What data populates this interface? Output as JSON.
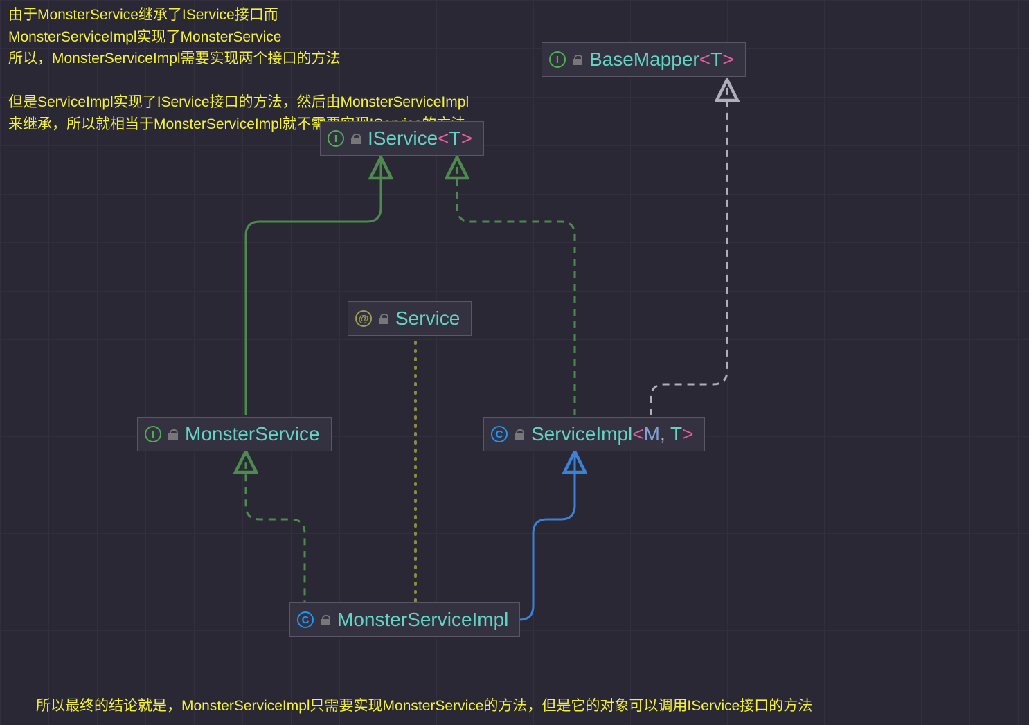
{
  "annotations": {
    "top": "由于MonsterService继承了IService接口而\nMonsterServiceImpl实现了MonsterService\n所以，MonsterServiceImpl需要实现两个接口的方法\n\n但是ServiceImpl实现了IService接口的方法，然后由MonsterServiceImpl\n来继承，所以就相当于MonsterServiceImpl就不需要实现IService的方法",
    "bottom": "所以最终的结论就是，MonsterServiceImpl只需要实现MonsterService的方法，但是它的对象可以调用IService接口的方法"
  },
  "nodes": {
    "basemapper": {
      "name": "BaseMapper",
      "generics": [
        {
          "txt": "<",
          "cls": "gen-br"
        },
        {
          "txt": "T",
          "cls": "gen-t"
        },
        {
          "txt": ">",
          "cls": "gen-br"
        }
      ],
      "kind": "interface"
    },
    "iservice": {
      "name": "IService",
      "generics": [
        {
          "txt": "<",
          "cls": "gen-br"
        },
        {
          "txt": "T",
          "cls": "gen-t"
        },
        {
          "txt": ">",
          "cls": "gen-br"
        }
      ],
      "kind": "interface"
    },
    "service": {
      "name": "Service",
      "generics": [],
      "kind": "annotation"
    },
    "monsterservice": {
      "name": "MonsterService",
      "generics": [],
      "kind": "interface"
    },
    "serviceimpl": {
      "name": "ServiceImpl",
      "generics": [
        {
          "txt": "<",
          "cls": "gen-br"
        },
        {
          "txt": "M",
          "cls": "gen-m"
        },
        {
          "txt": ", ",
          "cls": "comma"
        },
        {
          "txt": "T",
          "cls": "gen-t"
        },
        {
          "txt": ">",
          "cls": "gen-br"
        }
      ],
      "kind": "class"
    },
    "monsterserviceimpl": {
      "name": "MonsterServiceImpl",
      "generics": [],
      "kind": "class"
    }
  },
  "icon_glyphs": {
    "interface": "I",
    "class": "C",
    "annotation": "@"
  },
  "edges_legend": {
    "green_dashed": "implements",
    "blue_solid": "extends (class)",
    "green_solid": "extends (interface)",
    "grey_dashed": "dependency / uses",
    "olive_dotted": "annotated-by"
  }
}
